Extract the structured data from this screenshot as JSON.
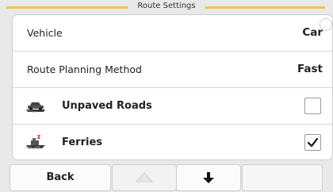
{
  "header": {
    "title": "Route Settings"
  },
  "rows": [
    {
      "label": "Vehicle",
      "value": "Car"
    },
    {
      "label": "Route Planning Method",
      "value": "Fast"
    },
    {
      "label": "Unpaved Roads",
      "icon": "unpaved-road-icon",
      "checked": false
    },
    {
      "label": "Ferries",
      "icon": "ferry-icon",
      "checked": true
    }
  ],
  "footer": {
    "back_label": "Back",
    "up_icon": "arrow-up-icon",
    "down_icon": "arrow-down-icon"
  },
  "colors": {
    "accent": "#f1c24d",
    "background": "#e9e9e9"
  }
}
